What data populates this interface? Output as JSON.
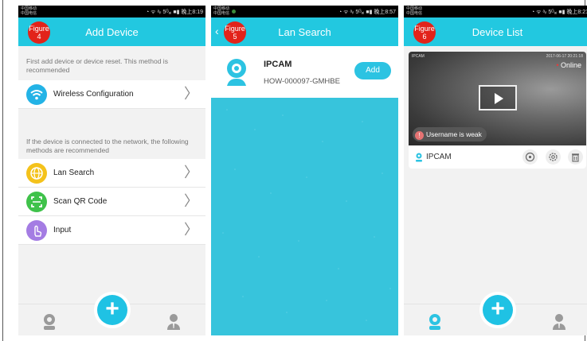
{
  "panel1": {
    "carrier": "中国移动\n中国电信",
    "status_right": "◔ ᯤ ᵃᵢₗ 5ᴳₐᵢ ■▮ 晚上8:19",
    "figure_label": "Figure\n4",
    "title": "Add Device",
    "note1": "First add device or device reset. This method is recommended",
    "item_wireless": "Wireless Configuration",
    "note2": "If the device is connected to the network, the following methods are recommended",
    "item_lan": "Lan Search",
    "item_qr": "Scan QR Code",
    "item_input": "Input",
    "chevron": "〉",
    "fab": "+"
  },
  "panel2": {
    "carrier": "中国移动\n中国电信",
    "status_right": "◔ ᯤ ᵃᵢₗ 5ᴳₐᵢ ■▮ 晚上8:57",
    "figure_label": "Figure\n5",
    "back": "‹",
    "title": "Lan Search",
    "device_name": "IPCAM",
    "device_id": "HOW-000097-GMHBE",
    "add_label": "Add"
  },
  "panel3": {
    "carrier": "中国移动\n中国电信",
    "status_right": "◔ ᯤ ᵃᵢₗ 5ᴳₐᵢ ■▮ 晚上8:21",
    "figure_label": "Figure\n6",
    "title": "Device List",
    "video_label_left": "IPCAM",
    "video_timestamp": "2017-06-17 20:21:18",
    "online_dot": "•",
    "online_label": "Online",
    "weak_icon": "!",
    "weak_label": "Username is weak",
    "device_name": "IPCAM",
    "fab": "+"
  },
  "colors": {
    "accent": "#22c8e0",
    "badge": "#e2231a",
    "online_dot": "#e83b3b"
  }
}
